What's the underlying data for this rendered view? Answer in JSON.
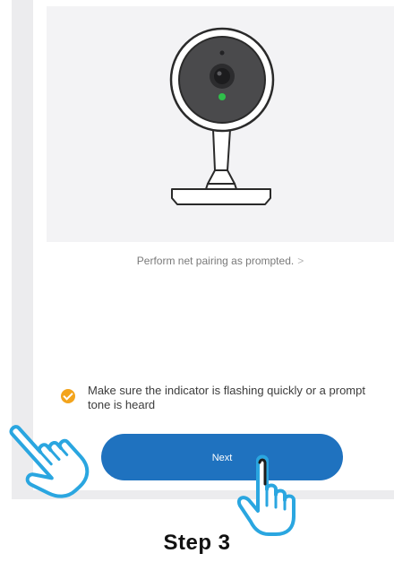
{
  "pairing": {
    "prompt_link": "Perform net pairing as prompted.",
    "chevron": ">",
    "confirm_text": "Make sure the indicator is flashing quickly or a prompt tone is heard",
    "confirm_checked": true,
    "next_label": "Next"
  },
  "caption": {
    "step_label": "Step 3"
  },
  "icons": {
    "camera": "security-camera-illustration",
    "check": "check-circle-icon",
    "hand_left": "pointing-hand-icon",
    "hand_right": "pointing-hand-icon"
  },
  "colors": {
    "accent": "#1f72bf",
    "check": "#f3a41c",
    "indicator_led": "#2fbf4a",
    "hand_outline": "#2aa6e0"
  }
}
